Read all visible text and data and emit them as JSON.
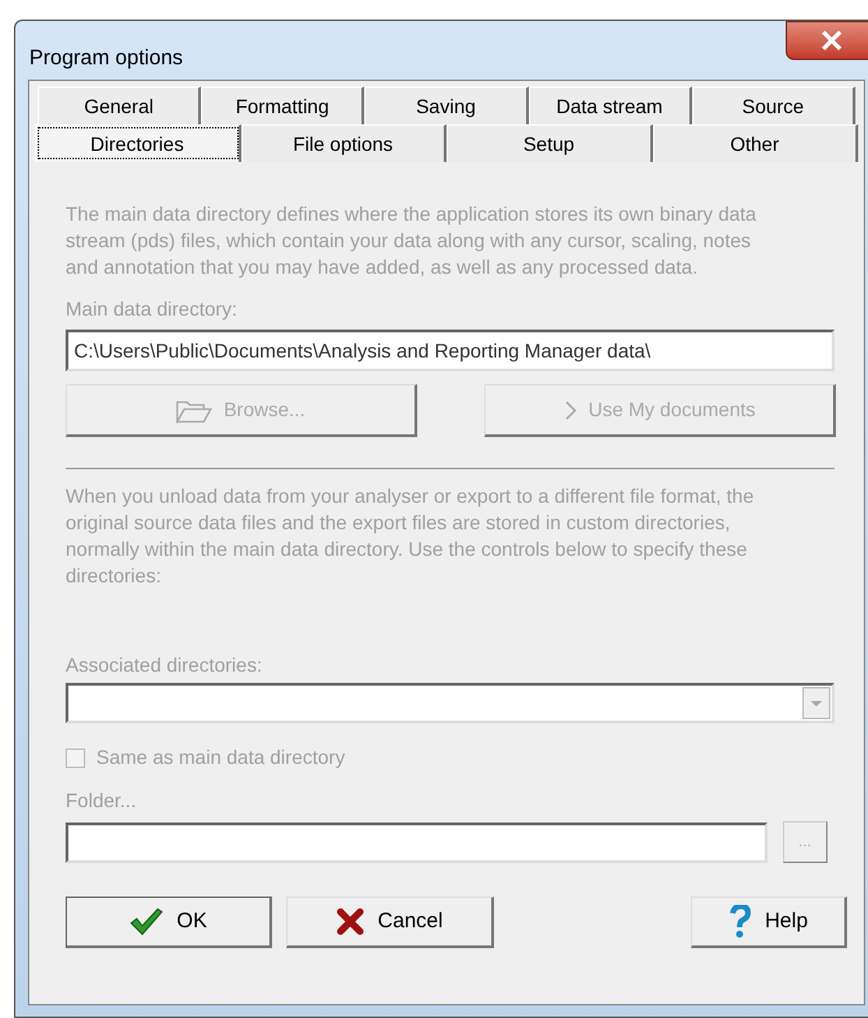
{
  "window": {
    "title": "Program options"
  },
  "tab_rows": [
    [
      {
        "label": "General",
        "selected": false
      },
      {
        "label": "Formatting",
        "selected": false
      },
      {
        "label": "Saving",
        "selected": false
      },
      {
        "label": "Data stream",
        "selected": false
      },
      {
        "label": "Source",
        "selected": false
      }
    ],
    [
      {
        "label": "Directories",
        "selected": true
      },
      {
        "label": "File options",
        "selected": false
      },
      {
        "label": "Setup",
        "selected": false
      },
      {
        "label": "Other",
        "selected": false
      }
    ]
  ],
  "intro": "The main data directory defines where the application stores its own binary data stream (pds) files, which contain your data along with any cursor, scaling, notes and annotation  that you may have added, as well as any processed data.",
  "main_directory": {
    "label": "Main data directory:",
    "value": "C:\\Users\\Public\\Documents\\Analysis and Reporting Manager data\\"
  },
  "directory_buttons": [
    {
      "label": "Browse...",
      "kind": "folder",
      "disabled": true
    },
    {
      "label": "Use My documents",
      "kind": "chevron",
      "disabled": true
    }
  ],
  "note": "When you unload data from your analyser or export to a different file format, the original source data files and the export files are stored in custom directories, normally within the main data directory.  Use the controls below to specify these directories:",
  "associated": {
    "label": "Associated directories:"
  },
  "same_as_main": {
    "label": "Same as main data directory",
    "checked": false,
    "disabled": true
  },
  "folder": {
    "label": "Folder...",
    "browse": "..."
  },
  "buttons": [
    {
      "label": "OK",
      "kind": "confirm"
    },
    {
      "label": "Cancel",
      "kind": "cancel"
    },
    {
      "label": "Help",
      "kind": "help"
    }
  ]
}
